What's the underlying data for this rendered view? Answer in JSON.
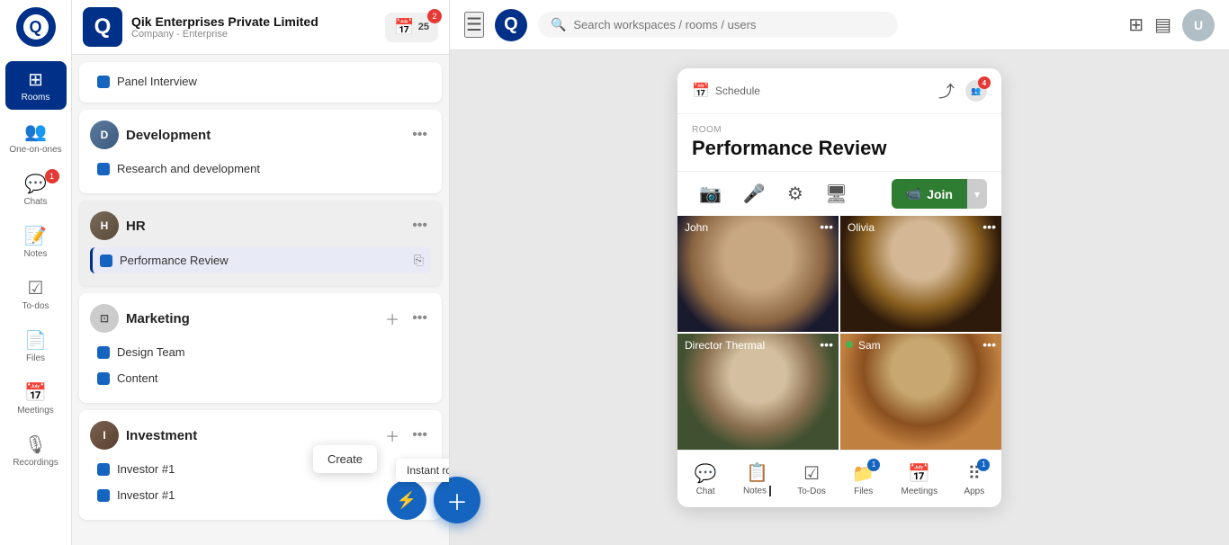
{
  "company": {
    "name": "Qik Enterprises Private Limited",
    "type": "Company - Enterprise",
    "calendar_date": "25",
    "calendar_badge": "2"
  },
  "nav": {
    "rooms_label": "Rooms",
    "one_on_ones_label": "One-on-ones",
    "chats_label": "Chats",
    "chats_badge": "1",
    "notes_label": "Notes",
    "todos_label": "To-dos",
    "files_label": "Files",
    "meetings_label": "Meetings",
    "recordings_label": "Recordings"
  },
  "header": {
    "search_placeholder": "Search workspaces / rooms / users"
  },
  "rooms_panel": {
    "groups": [
      {
        "id": "development",
        "name": "Development",
        "avatar": "D",
        "rooms": [
          {
            "id": "research",
            "label": "Research and development",
            "color": "blue"
          },
          {
            "id": "panel",
            "label": "Panel Interview",
            "color": "blue"
          }
        ]
      },
      {
        "id": "hr",
        "name": "HR",
        "avatar": "HR",
        "rooms": [
          {
            "id": "perf",
            "label": "Performance Review",
            "color": "blue",
            "active": true
          }
        ]
      },
      {
        "id": "marketing",
        "name": "Marketing",
        "avatar": "M",
        "rooms": [
          {
            "id": "design",
            "label": "Design Team",
            "color": "blue"
          },
          {
            "id": "content",
            "label": "Content",
            "color": "blue"
          }
        ]
      },
      {
        "id": "investment",
        "name": "Investment",
        "avatar": "I",
        "rooms": [
          {
            "id": "investor1",
            "label": "Investor #1",
            "color": "blue"
          },
          {
            "id": "investor1b",
            "label": "Investor #1",
            "color": "blue"
          }
        ]
      }
    ]
  },
  "room_card": {
    "schedule_label": "Schedule",
    "member_count": "4",
    "room_label": "Room",
    "title": "Performance Review",
    "join_label": "Join",
    "participants": [
      {
        "id": "john",
        "name": "John",
        "style": "john"
      },
      {
        "id": "olivia",
        "name": "Olivia",
        "style": "olivia"
      },
      {
        "id": "director",
        "name": "Director Thermal",
        "style": "director"
      },
      {
        "id": "sam",
        "name": "Sam",
        "style": "sam"
      }
    ],
    "bottom_bar": [
      {
        "id": "chat",
        "label": "Chat",
        "icon": "💬",
        "badge": null
      },
      {
        "id": "notes",
        "label": "Notes _",
        "icon": "📋",
        "badge": null
      },
      {
        "id": "todos",
        "label": "To-Dos",
        "icon": "☑",
        "badge": null
      },
      {
        "id": "files",
        "label": "Files",
        "icon": "📁",
        "badge": "1"
      },
      {
        "id": "meetings",
        "label": "Meetings",
        "icon": "📅",
        "badge": null
      },
      {
        "id": "apps",
        "label": "Apps",
        "icon": "⠿",
        "badge": "1"
      }
    ]
  },
  "tooltips": {
    "create": "Create",
    "instant_room": "Instant room"
  },
  "colors": {
    "primary": "#003087",
    "accent": "#1565c0",
    "green": "#2e7d32"
  }
}
